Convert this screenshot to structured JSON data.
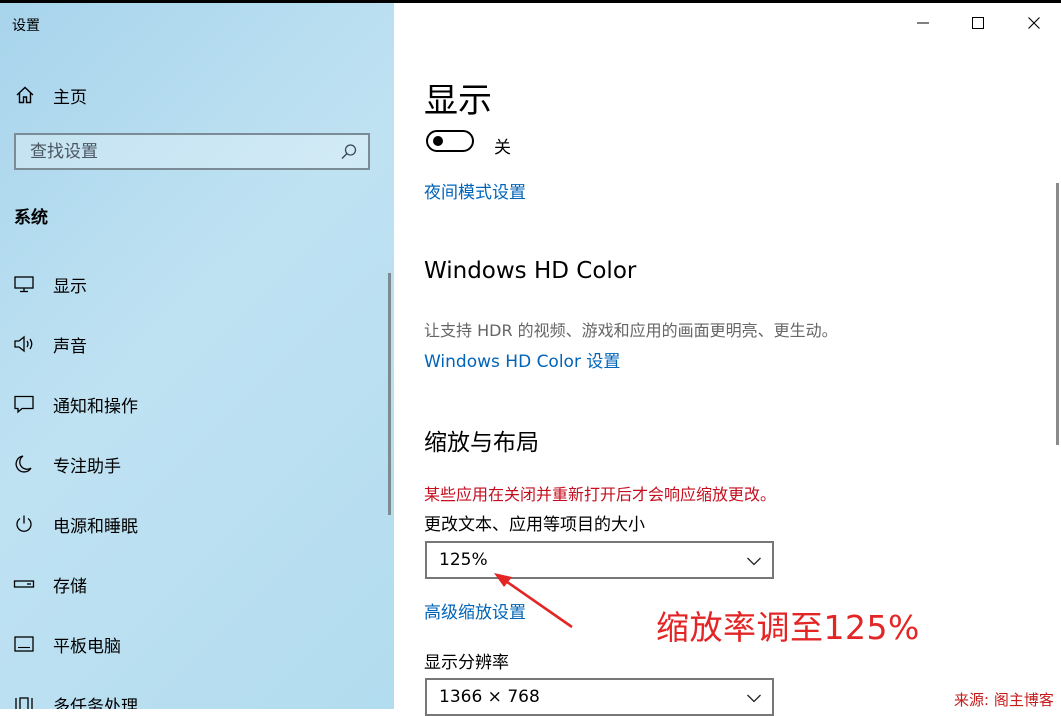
{
  "window": {
    "title": "设置",
    "controls": [
      "minimize",
      "maximize",
      "close"
    ]
  },
  "sidebar": {
    "home_label": "主页",
    "search": {
      "placeholder": "查找设置"
    },
    "section_title": "系统",
    "items": [
      {
        "label": "显示",
        "icon": "monitor-icon"
      },
      {
        "label": "声音",
        "icon": "speaker-icon"
      },
      {
        "label": "通知和操作",
        "icon": "notification-icon"
      },
      {
        "label": "专注助手",
        "icon": "moon-icon"
      },
      {
        "label": "电源和睡眠",
        "icon": "power-icon"
      },
      {
        "label": "存储",
        "icon": "storage-icon"
      },
      {
        "label": "平板电脑",
        "icon": "tablet-icon"
      },
      {
        "label": "多任务处理",
        "icon": "multitask-icon"
      }
    ]
  },
  "main": {
    "page_title": "显示",
    "night_light": {
      "state": "off",
      "state_label": "关",
      "settings_link": "夜间模式设置"
    },
    "hd_color": {
      "heading": "Windows HD Color",
      "description": "让支持 HDR 的视频、游戏和应用的画面更明亮、更生动。",
      "settings_link": "Windows HD Color 设置"
    },
    "scale_layout": {
      "heading": "缩放与布局",
      "warning": "某些应用在关闭并重新打开后才会响应缩放更改。",
      "scale_label": "更改文本、应用等项目的大小",
      "scale_value": "125%",
      "advanced_link": "高级缩放设置",
      "resolution_label": "显示分辨率",
      "resolution_value": "1366 × 768"
    }
  },
  "annotation": {
    "text": "缩放率调至125%",
    "color": "#e32525"
  },
  "watermark": "来源: 阁主博客",
  "colors": {
    "accent_link": "#0064b8",
    "warning": "#c50f1f",
    "sidebar_bg": "#b8def0"
  }
}
